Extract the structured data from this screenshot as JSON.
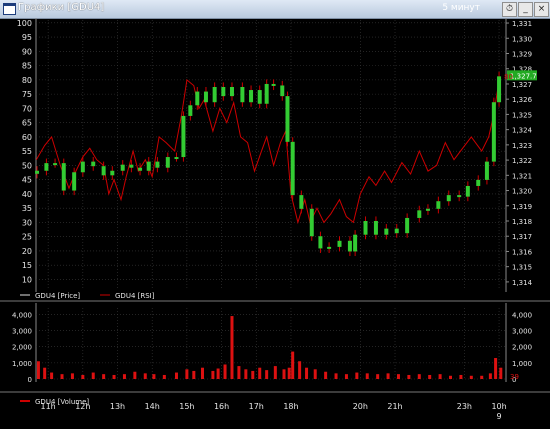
{
  "window": {
    "title": "Графики [GDU4]",
    "right_caption": "5 минут"
  },
  "chart_data": [
    {
      "type": "line",
      "name": "price-rsi-panel",
      "left_axis": {
        "ticks": [
          10,
          15,
          20,
          25,
          30,
          35,
          40,
          45,
          50,
          55,
          60,
          65,
          70,
          75,
          80,
          85,
          90,
          95,
          100
        ],
        "range": [
          7,
          101
        ]
      },
      "right_axis": {
        "ticks": [
          "1,314",
          "1,315",
          "1,316",
          "1,317",
          "1,318",
          "1,319",
          "1,320",
          "1,321",
          "1,322",
          "1,323",
          "1,324",
          "1,325",
          "1,326",
          "1,327",
          "1,328",
          "1,329",
          "1,330",
          "1,331"
        ],
        "range": [
          1.3136,
          1.3312
        ]
      },
      "price_tag": "1,327.7",
      "rsi_tag": "80",
      "legend": [
        {
          "label": "GDU4 [Price]",
          "color": "#e0e0e0"
        },
        {
          "label": "GDU4 [RSI]",
          "color": "#cc0000"
        }
      ],
      "series": [
        {
          "name": "GDU4 [Price]",
          "style": "candles",
          "points": [
            [
              10.68,
              1.3213
            ],
            [
              10.95,
              1.3218
            ],
            [
              11.2,
              1.3218
            ],
            [
              11.45,
              1.32
            ],
            [
              11.75,
              1.3212
            ],
            [
              12.0,
              1.3219
            ],
            [
              12.3,
              1.3216
            ],
            [
              12.6,
              1.321
            ],
            [
              12.85,
              1.3213
            ],
            [
              13.15,
              1.3217
            ],
            [
              13.4,
              1.3215
            ],
            [
              13.65,
              1.3213
            ],
            [
              13.9,
              1.3219
            ],
            [
              14.15,
              1.3215
            ],
            [
              14.45,
              1.3222
            ],
            [
              14.7,
              1.3222
            ],
            [
              14.9,
              1.3249
            ],
            [
              15.1,
              1.3256
            ],
            [
              15.3,
              1.3265
            ],
            [
              15.55,
              1.3258
            ],
            [
              15.8,
              1.3268
            ],
            [
              16.05,
              1.3262
            ],
            [
              16.3,
              1.3268
            ],
            [
              16.6,
              1.3258
            ],
            [
              16.85,
              1.3266
            ],
            [
              17.1,
              1.3257
            ],
            [
              17.3,
              1.327
            ],
            [
              17.5,
              1.3269
            ],
            [
              17.75,
              1.3262
            ],
            [
              17.9,
              1.3232
            ],
            [
              18.05,
              1.3197
            ],
            [
              18.3,
              1.3188
            ],
            [
              18.6,
              1.317
            ],
            [
              18.85,
              1.3162
            ],
            [
              19.1,
              1.3163
            ],
            [
              19.4,
              1.3167
            ],
            [
              19.7,
              1.316
            ],
            [
              19.85,
              1.3171
            ],
            [
              20.15,
              1.318
            ],
            [
              20.45,
              1.3171
            ],
            [
              20.75,
              1.3175
            ],
            [
              21.05,
              1.3172
            ],
            [
              21.35,
              1.3182
            ],
            [
              21.7,
              1.3187
            ],
            [
              21.95,
              1.3188
            ],
            [
              22.25,
              1.3193
            ],
            [
              22.55,
              1.3197
            ],
            [
              22.85,
              1.3196
            ],
            [
              23.1,
              1.3203
            ],
            [
              23.4,
              1.3207
            ],
            [
              23.65,
              1.3219
            ],
            [
              23.85,
              1.3258
            ],
            [
              24.0,
              1.3275
            ]
          ]
        },
        {
          "name": "GDU4 [RSI]",
          "style": "line",
          "points": [
            [
              10.66,
              52
            ],
            [
              10.9,
              57
            ],
            [
              11.1,
              60
            ],
            [
              11.35,
              50
            ],
            [
              11.6,
              42
            ],
            [
              11.8,
              48
            ],
            [
              12.0,
              53
            ],
            [
              12.2,
              56
            ],
            [
              12.4,
              52
            ],
            [
              12.6,
              50
            ],
            [
              12.75,
              40
            ],
            [
              12.9,
              45
            ],
            [
              13.1,
              38
            ],
            [
              13.25,
              46
            ],
            [
              13.45,
              55
            ],
            [
              13.6,
              48
            ],
            [
              13.8,
              52
            ],
            [
              14.0,
              46
            ],
            [
              14.2,
              60
            ],
            [
              14.4,
              58
            ],
            [
              14.65,
              55
            ],
            [
              14.85,
              68
            ],
            [
              15.0,
              80
            ],
            [
              15.2,
              78
            ],
            [
              15.35,
              70
            ],
            [
              15.5,
              73
            ],
            [
              15.75,
              62
            ],
            [
              15.95,
              70
            ],
            [
              16.15,
              65
            ],
            [
              16.35,
              72
            ],
            [
              16.55,
              60
            ],
            [
              16.75,
              58
            ],
            [
              16.95,
              48
            ],
            [
              17.15,
              55
            ],
            [
              17.3,
              60
            ],
            [
              17.5,
              50
            ],
            [
              17.7,
              58
            ],
            [
              17.85,
              62
            ],
            [
              18.0,
              40
            ],
            [
              18.2,
              30
            ],
            [
              18.4,
              38
            ],
            [
              18.55,
              30
            ],
            [
              18.75,
              35
            ],
            [
              18.95,
              30
            ],
            [
              19.15,
              33
            ],
            [
              19.4,
              38
            ],
            [
              19.6,
              32
            ],
            [
              19.8,
              30
            ],
            [
              20.0,
              40
            ],
            [
              20.25,
              46
            ],
            [
              20.45,
              43
            ],
            [
              20.7,
              48
            ],
            [
              20.9,
              44
            ],
            [
              21.2,
              51
            ],
            [
              21.45,
              47
            ],
            [
              21.7,
              55
            ],
            [
              21.95,
              48
            ],
            [
              22.2,
              50
            ],
            [
              22.45,
              58
            ],
            [
              22.7,
              52
            ],
            [
              22.95,
              56
            ],
            [
              23.2,
              60
            ],
            [
              23.5,
              55
            ],
            [
              23.7,
              60
            ],
            [
              23.85,
              68
            ],
            [
              24.0,
              80
            ]
          ]
        }
      ]
    },
    {
      "type": "bar",
      "name": "volume-panel",
      "axis_ticks": [
        "4,000",
        "3,000",
        "2,000",
        "1,000",
        "0"
      ],
      "right_axis_ticks": [
        "4,000",
        "3,000",
        "2,000",
        "1,000",
        "0"
      ],
      "ylim": [
        0,
        4400
      ],
      "volume_tag": "39",
      "legend": [
        {
          "label": "GDU4 [Volume]",
          "color": "#cc0000"
        }
      ],
      "bars": [
        [
          10.72,
          1100
        ],
        [
          10.9,
          700
        ],
        [
          11.1,
          400
        ],
        [
          11.4,
          300
        ],
        [
          11.7,
          350
        ],
        [
          12.0,
          250
        ],
        [
          12.3,
          400
        ],
        [
          12.6,
          300
        ],
        [
          12.9,
          250
        ],
        [
          13.2,
          300
        ],
        [
          13.5,
          450
        ],
        [
          13.8,
          350
        ],
        [
          14.05,
          300
        ],
        [
          14.35,
          250
        ],
        [
          14.7,
          400
        ],
        [
          15.0,
          600
        ],
        [
          15.2,
          500
        ],
        [
          15.45,
          700
        ],
        [
          15.75,
          500
        ],
        [
          15.9,
          650
        ],
        [
          16.1,
          900
        ],
        [
          16.3,
          3900
        ],
        [
          16.5,
          800
        ],
        [
          16.7,
          600
        ],
        [
          16.9,
          500
        ],
        [
          17.1,
          700
        ],
        [
          17.3,
          550
        ],
        [
          17.55,
          800
        ],
        [
          17.8,
          600
        ],
        [
          17.95,
          700
        ],
        [
          18.05,
          1700
        ],
        [
          18.25,
          1100
        ],
        [
          18.45,
          700
        ],
        [
          18.7,
          600
        ],
        [
          19.0,
          450
        ],
        [
          19.3,
          350
        ],
        [
          19.6,
          300
        ],
        [
          19.9,
          400
        ],
        [
          20.2,
          350
        ],
        [
          20.5,
          300
        ],
        [
          20.8,
          350
        ],
        [
          21.1,
          300
        ],
        [
          21.4,
          250
        ],
        [
          21.7,
          300
        ],
        [
          22.0,
          250
        ],
        [
          22.3,
          300
        ],
        [
          22.6,
          200
        ],
        [
          22.9,
          250
        ],
        [
          23.2,
          200
        ],
        [
          23.5,
          200
        ],
        [
          23.75,
          350
        ],
        [
          23.9,
          1300
        ],
        [
          24.05,
          700
        ]
      ]
    },
    {
      "type": "axis",
      "name": "time-axis",
      "ticks": [
        {
          "hour": 11,
          "label": "11h"
        },
        {
          "hour": 12,
          "label": "12h"
        },
        {
          "hour": 13,
          "label": "13h"
        },
        {
          "hour": 14,
          "label": "14h"
        },
        {
          "hour": 15,
          "label": "15h"
        },
        {
          "hour": 16,
          "label": "16h"
        },
        {
          "hour": 17,
          "label": "17h"
        },
        {
          "hour": 18,
          "label": "18h"
        },
        {
          "hour": 20,
          "label": "20h"
        },
        {
          "hour": 21,
          "label": "21h"
        },
        {
          "hour": 23,
          "label": "23h"
        },
        {
          "hour": 24,
          "label": "10h"
        }
      ],
      "day_label": "9",
      "range": [
        10.65,
        24.2
      ]
    }
  ],
  "colors": {
    "background": "#000000",
    "grid": "#3a3a3a",
    "axis_text": "#e6e6e6",
    "candle_up": "#33cc33",
    "candle_wick": "#cc0000",
    "rsi": "#cc0000",
    "volume": "#dd1111",
    "price_tag_bg": "#22aa22"
  }
}
